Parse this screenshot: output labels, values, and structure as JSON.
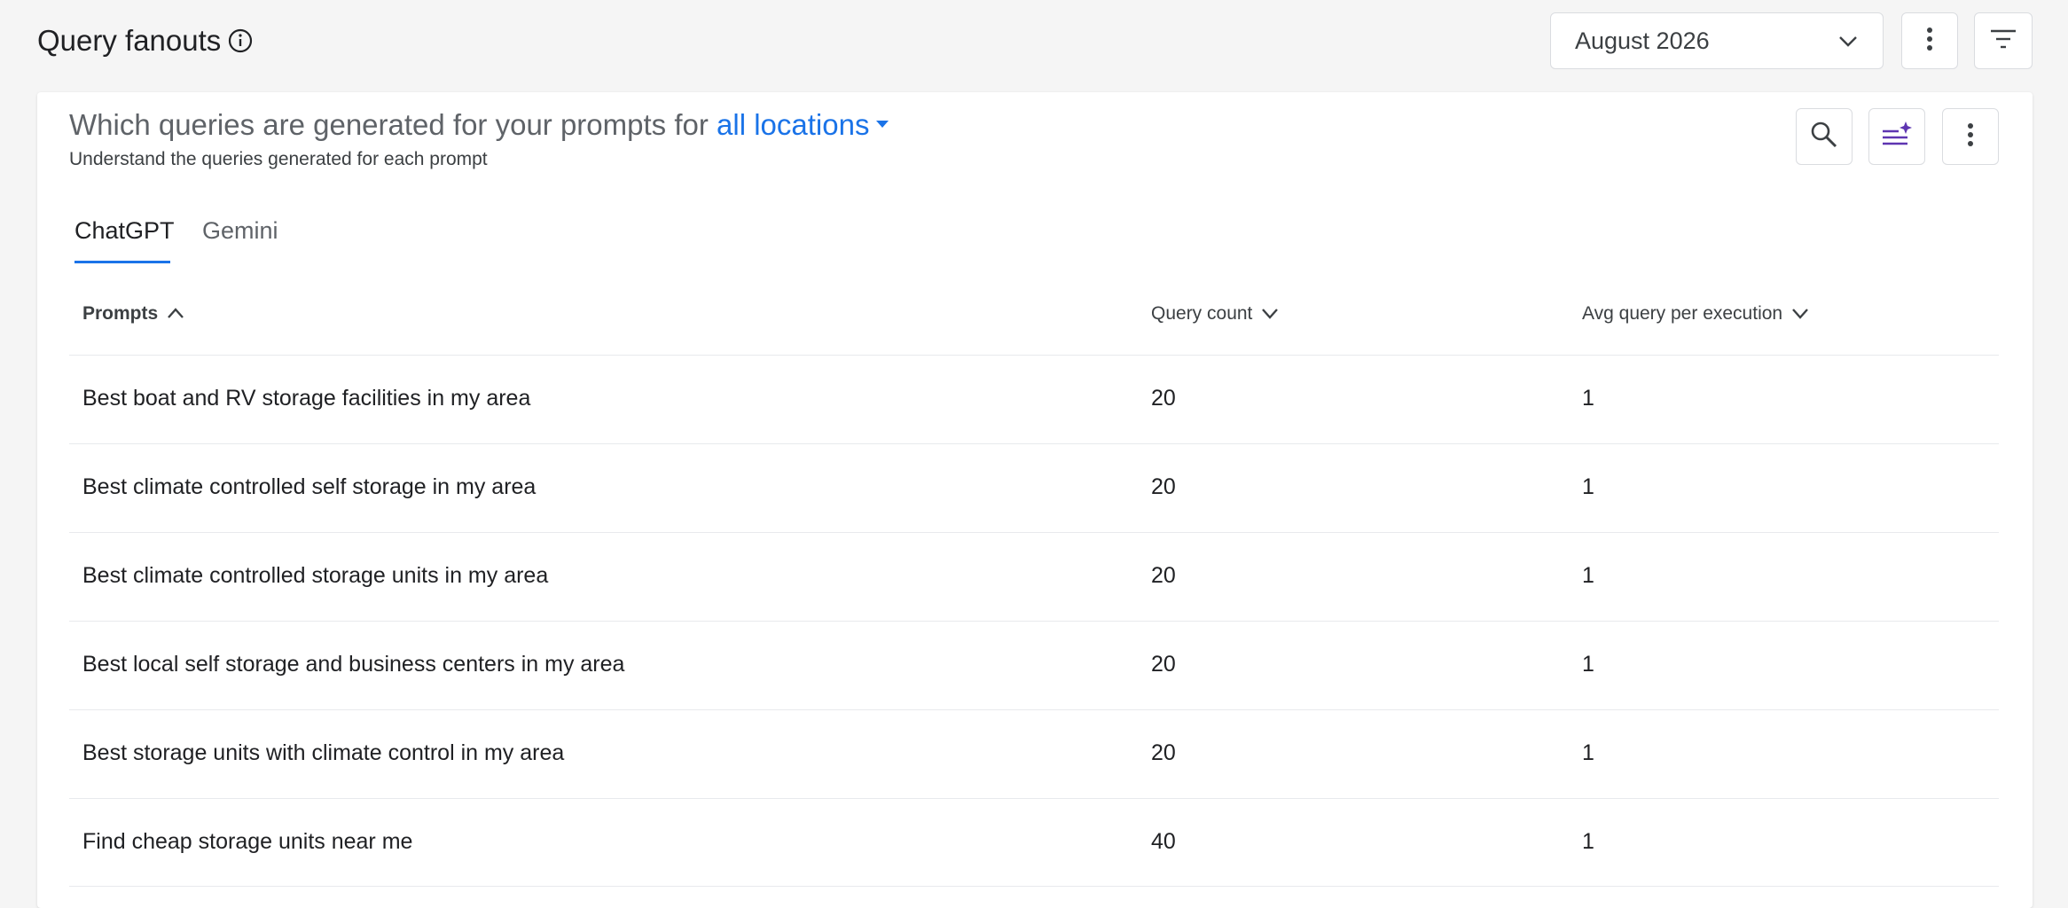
{
  "header": {
    "title": "Query fanouts",
    "month": "August 2026"
  },
  "card": {
    "title_prefix": "Which queries are generated for your prompts for",
    "location": "all locations",
    "subtitle": "Understand the queries generated for each prompt"
  },
  "tabs": [
    {
      "label": "ChatGPT",
      "active": true
    },
    {
      "label": "Gemini",
      "active": false
    }
  ],
  "table": {
    "columns": [
      "Prompts",
      "Query count",
      "Avg query per execution"
    ],
    "rows": [
      {
        "prompt": "Best boat and RV storage facilities in my area",
        "count": "20",
        "avg": "1"
      },
      {
        "prompt": "Best climate controlled self storage in my area",
        "count": "20",
        "avg": "1"
      },
      {
        "prompt": "Best climate controlled storage units in my area",
        "count": "20",
        "avg": "1"
      },
      {
        "prompt": "Best local self storage and business centers in my area",
        "count": "20",
        "avg": "1"
      },
      {
        "prompt": "Best storage units with climate control in my area",
        "count": "20",
        "avg": "1"
      },
      {
        "prompt": "Find cheap storage units near me",
        "count": "40",
        "avg": "1"
      }
    ]
  },
  "colors": {
    "accent": "#1a73e8",
    "ai_icon": "#5e35b1",
    "text": "#202124",
    "muted": "#5f6368"
  },
  "icons": [
    "info-icon",
    "chevron-down-icon",
    "more-vert-icon",
    "filter-icon",
    "search-icon",
    "ai-sparkle-icon",
    "sort-asc-icon",
    "sort-desc-icon"
  ]
}
